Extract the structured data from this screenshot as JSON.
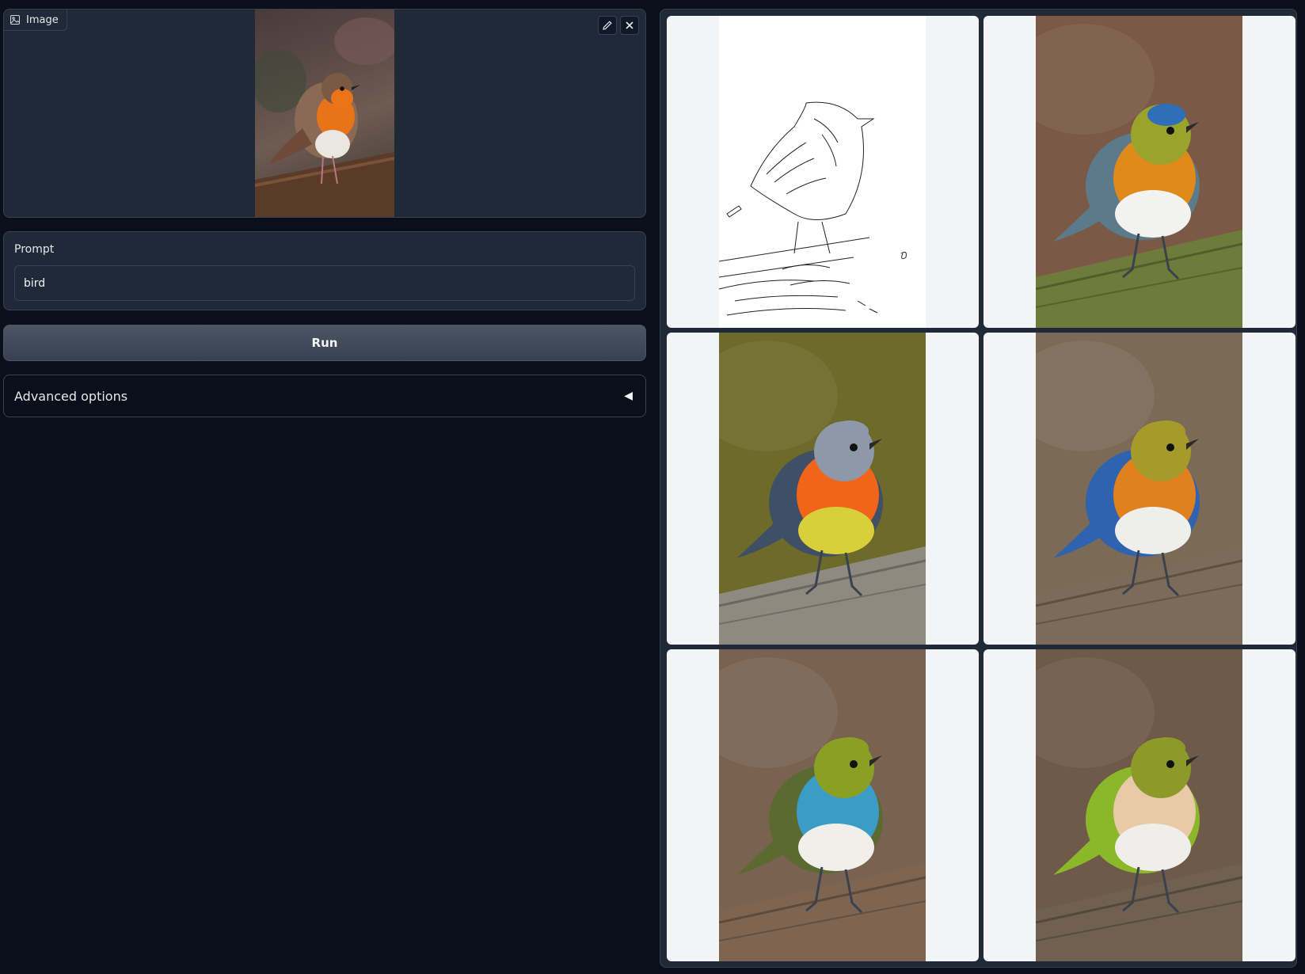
{
  "image_input": {
    "label": "Image",
    "icon": "image-icon",
    "edit_icon": "pencil-icon",
    "clear_icon": "close-icon"
  },
  "prompt": {
    "label": "Prompt",
    "value": "bird"
  },
  "run_button": {
    "label": "Run"
  },
  "advanced": {
    "label": "Advanced options",
    "arrow": "◀"
  },
  "colors": {
    "background": "#0b0f19",
    "panel": "#1f2937",
    "border": "#374151",
    "button": "#4b5563",
    "gallery_cell": "#f3f4f6"
  },
  "gallery": {
    "items": [
      {
        "kind": "edge-map"
      },
      {
        "kind": "generated-bird",
        "bg": "#7a5a46",
        "body": "#e08a1c",
        "head": "#9aa32a",
        "cap": "#2f6fb8",
        "wing": "#5b7a8a",
        "belly": "#f2f2ee",
        "perch": "#6f7b3a"
      },
      {
        "kind": "generated-bird",
        "bg": "#6d6a2a",
        "body": "#f2641a",
        "head": "#8d98a8",
        "cap": "#8d98a8",
        "wing": "#3f5066",
        "belly": "#d9cf3a",
        "perch": "#8f8a80"
      },
      {
        "kind": "generated-bird",
        "bg": "#7b6a55",
        "body": "#e0801e",
        "head": "#a69a2a",
        "cap": "#a69a2a",
        "wing": "#2f63b0",
        "belly": "#eeeeea",
        "perch": "#7c6b58"
      },
      {
        "kind": "generated-bird",
        "bg": "#7a6250",
        "body": "#3a9cc7",
        "head": "#8ba022",
        "cap": "#8ba022",
        "wing": "#5a6a30",
        "belly": "#f1efe9",
        "perch": "#7d6552"
      },
      {
        "kind": "generated-bird",
        "bg": "#6f5a4a",
        "body": "#e8c9a8",
        "head": "#8d9a2a",
        "cap": "#8d9a2a",
        "wing": "#8bb82a",
        "belly": "#f0eeea",
        "perch": "#6f6050"
      }
    ]
  }
}
